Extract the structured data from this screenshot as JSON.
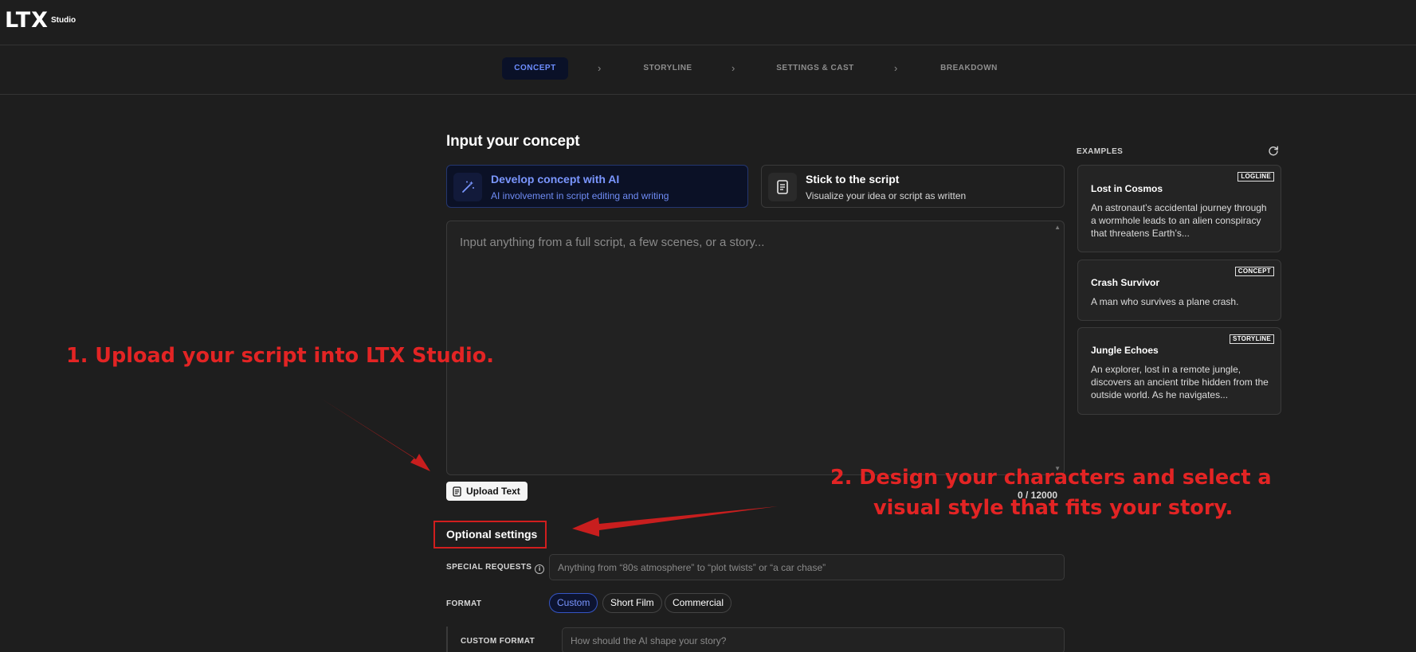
{
  "logo": {
    "main": "LTX",
    "sub": "Studio"
  },
  "stepper": {
    "steps": [
      "CONCEPT",
      "STORYLINE",
      "SETTINGS & CAST",
      "BREAKDOWN"
    ]
  },
  "concept": {
    "heading": "Input your concept",
    "modes": [
      {
        "title": "Develop concept with AI",
        "subtitle": "AI involvement in script editing and writing",
        "icon": "magic-wand-icon",
        "active": true
      },
      {
        "title": "Stick to the script",
        "subtitle": "Visualize your idea or script as written",
        "icon": "document-icon",
        "active": false
      }
    ],
    "textarea_placeholder": "Input anything from a full script, a few scenes, or a story...",
    "upload_label": "Upload Text",
    "counter": "0 / 12000"
  },
  "optional": {
    "title": "Optional settings",
    "special_requests_label": "SPECIAL REQUESTS",
    "special_requests_placeholder": "Anything from “80s atmosphere” to “plot twists” or “a car chase”",
    "format_label": "FORMAT",
    "format_options": [
      "Custom",
      "Short Film",
      "Commercial"
    ],
    "format_selected": "Custom",
    "custom_format_label": "CUSTOM FORMAT",
    "custom_format_placeholder": "How should the AI shape your story?"
  },
  "examples": {
    "label": "EXAMPLES",
    "items": [
      {
        "badge": "LOGLINE",
        "title": "Lost in Cosmos",
        "desc": "An astronaut’s accidental journey through a wormhole leads to an alien conspiracy that threatens Earth’s..."
      },
      {
        "badge": "CONCEPT",
        "title": "Crash Survivor",
        "desc": "A man who survives a plane crash."
      },
      {
        "badge": "STORYLINE",
        "title": "Jungle Echoes",
        "desc": "An explorer, lost in a remote jungle, discovers an ancient tribe hidden from the outside world. As he navigates..."
      }
    ]
  },
  "annotations": {
    "one": "1. Upload your script into LTX Studio.",
    "two_line1": "2. Design your characters and select a",
    "two_line2": "visual style that fits your story."
  },
  "colors": {
    "background": "#1e1e1e",
    "accent_blue": "#6d8dff",
    "annotation_red": "#e32424"
  }
}
